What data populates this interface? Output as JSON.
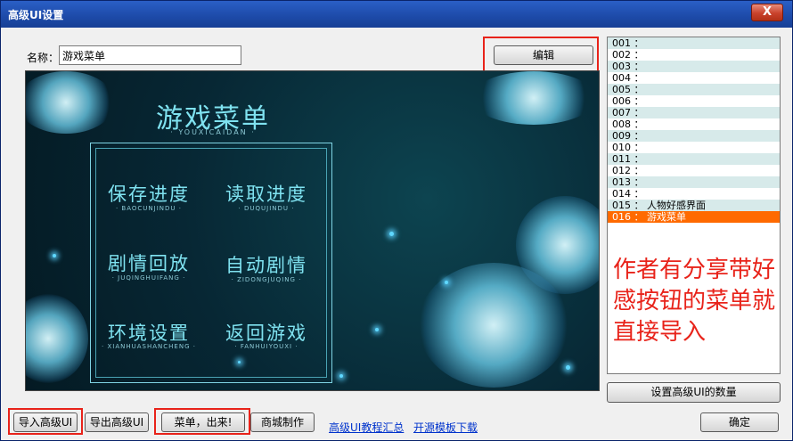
{
  "window": {
    "title": "高级UI设置",
    "close_glyph": "X"
  },
  "name_label": "名称：",
  "name_value": "游戏菜单",
  "edit_button": "编辑",
  "preview": {
    "title": "游戏菜单",
    "title_pinyin": "· YOUXICAIDAN ·",
    "items": [
      {
        "label": "保存进度",
        "pinyin": "· BAOCUNJINDU ·"
      },
      {
        "label": "读取进度",
        "pinyin": "· DUQUJINDU ·"
      },
      {
        "label": "剧情回放",
        "pinyin": "· JUQINGHUIFANG ·"
      },
      {
        "label": "自动剧情",
        "pinyin": "· ZIDONGJUQING ·"
      },
      {
        "label": "环境设置",
        "pinyin": "· XIANHUASHANCHENG ·"
      },
      {
        "label": "返回游戏",
        "pinyin": "· FANHUIYOUXI ·"
      }
    ]
  },
  "list": [
    "001 ：",
    "002 ：",
    "003 ：",
    "004 ：",
    "005 ：",
    "006 ：",
    "007 ：",
    "008 ：",
    "009 ：",
    "010 ：",
    "011 ：",
    "012 ：",
    "013 ：",
    "014 ：",
    "015 ： 人物好感界面",
    "016 ： 游戏菜单"
  ],
  "selected_index": 15,
  "note": "作者有分享带好感按钮的菜单就直接导入",
  "set_count_button": "设置高级UI的数量",
  "bottom": {
    "import": "导入高级UI",
    "export": "导出高级UI",
    "menu_out": "菜单，出来!",
    "shop": "商城制作",
    "link1": "高级UI教程汇总",
    "link2": "开源模板下载",
    "ok": "确定"
  },
  "colors": {
    "highlight": "#e8231a",
    "selected_row": "#ff6a00",
    "title_bar": "#1d4aa8",
    "link": "#0033cc"
  }
}
